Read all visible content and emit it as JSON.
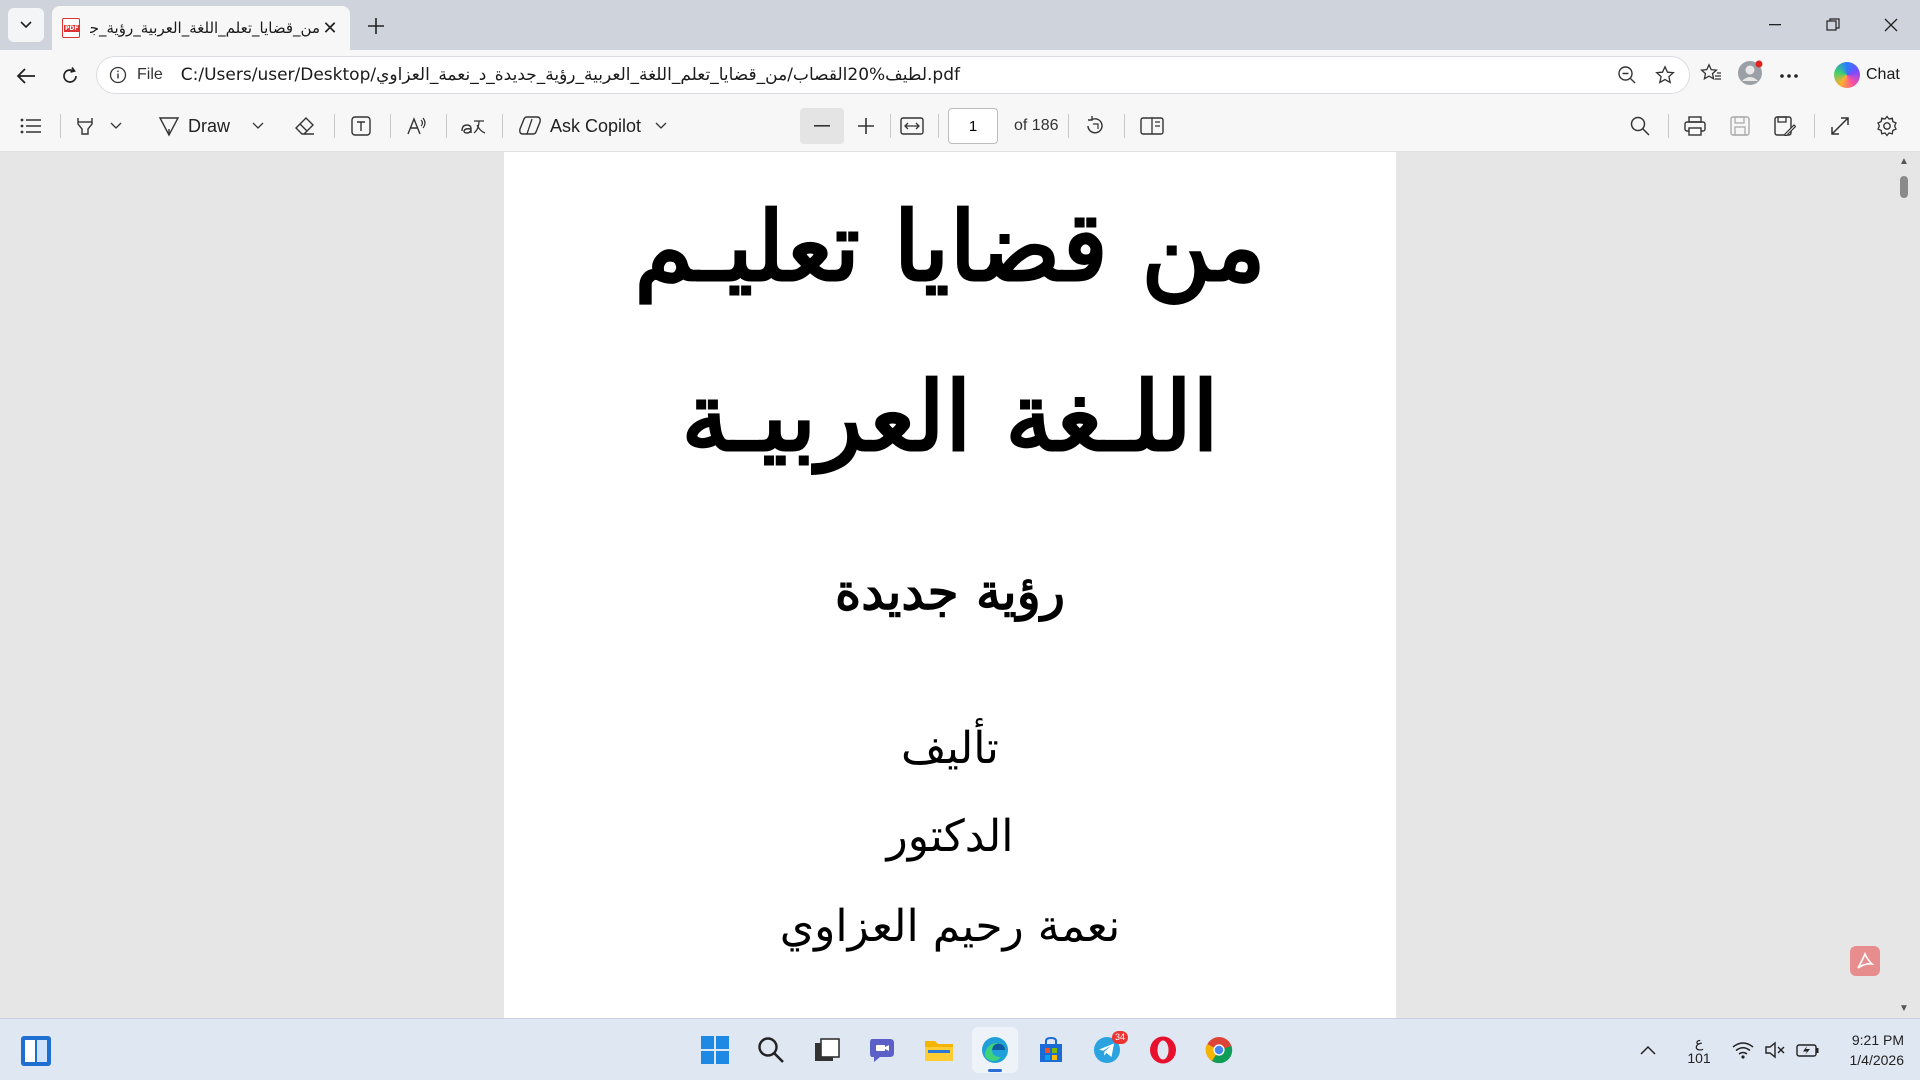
{
  "browser": {
    "tab_title": "من_قضايا_تعلم_اللغة_العربية_رؤية_جديدة",
    "file_label": "File",
    "url": "C:/Users/user/Desktop/لطيف%20القصاب/من_قضايا_تعلم_اللغة_العربية_رؤية_جديدة_د_نعمة_العزاوي.pdf",
    "chat_label": "Chat"
  },
  "pdf_toolbar": {
    "draw_label": "Draw",
    "ask_copilot_label": "Ask Copilot",
    "page_number": "1",
    "page_of": "of 186"
  },
  "document": {
    "title_line1": "من قضايا تعليـم",
    "title_line2": "اللـغة العربيـة",
    "subtitle": "رؤية جديدة",
    "author_label": "تأليف",
    "author_title": "الدكتور",
    "author_name": "نعمة رحيم العزاوي"
  },
  "taskbar": {
    "telegram_badge": "34",
    "lang_line1": "ع",
    "lang_line2": "101",
    "time": "9:21 PM",
    "date": "1/4/2026"
  },
  "colors": {
    "accent": "#2b6fd6",
    "pdf_red": "#d33333",
    "toolbar_bg": "#f7f7f7",
    "viewer_bg": "#e6e6e6"
  }
}
